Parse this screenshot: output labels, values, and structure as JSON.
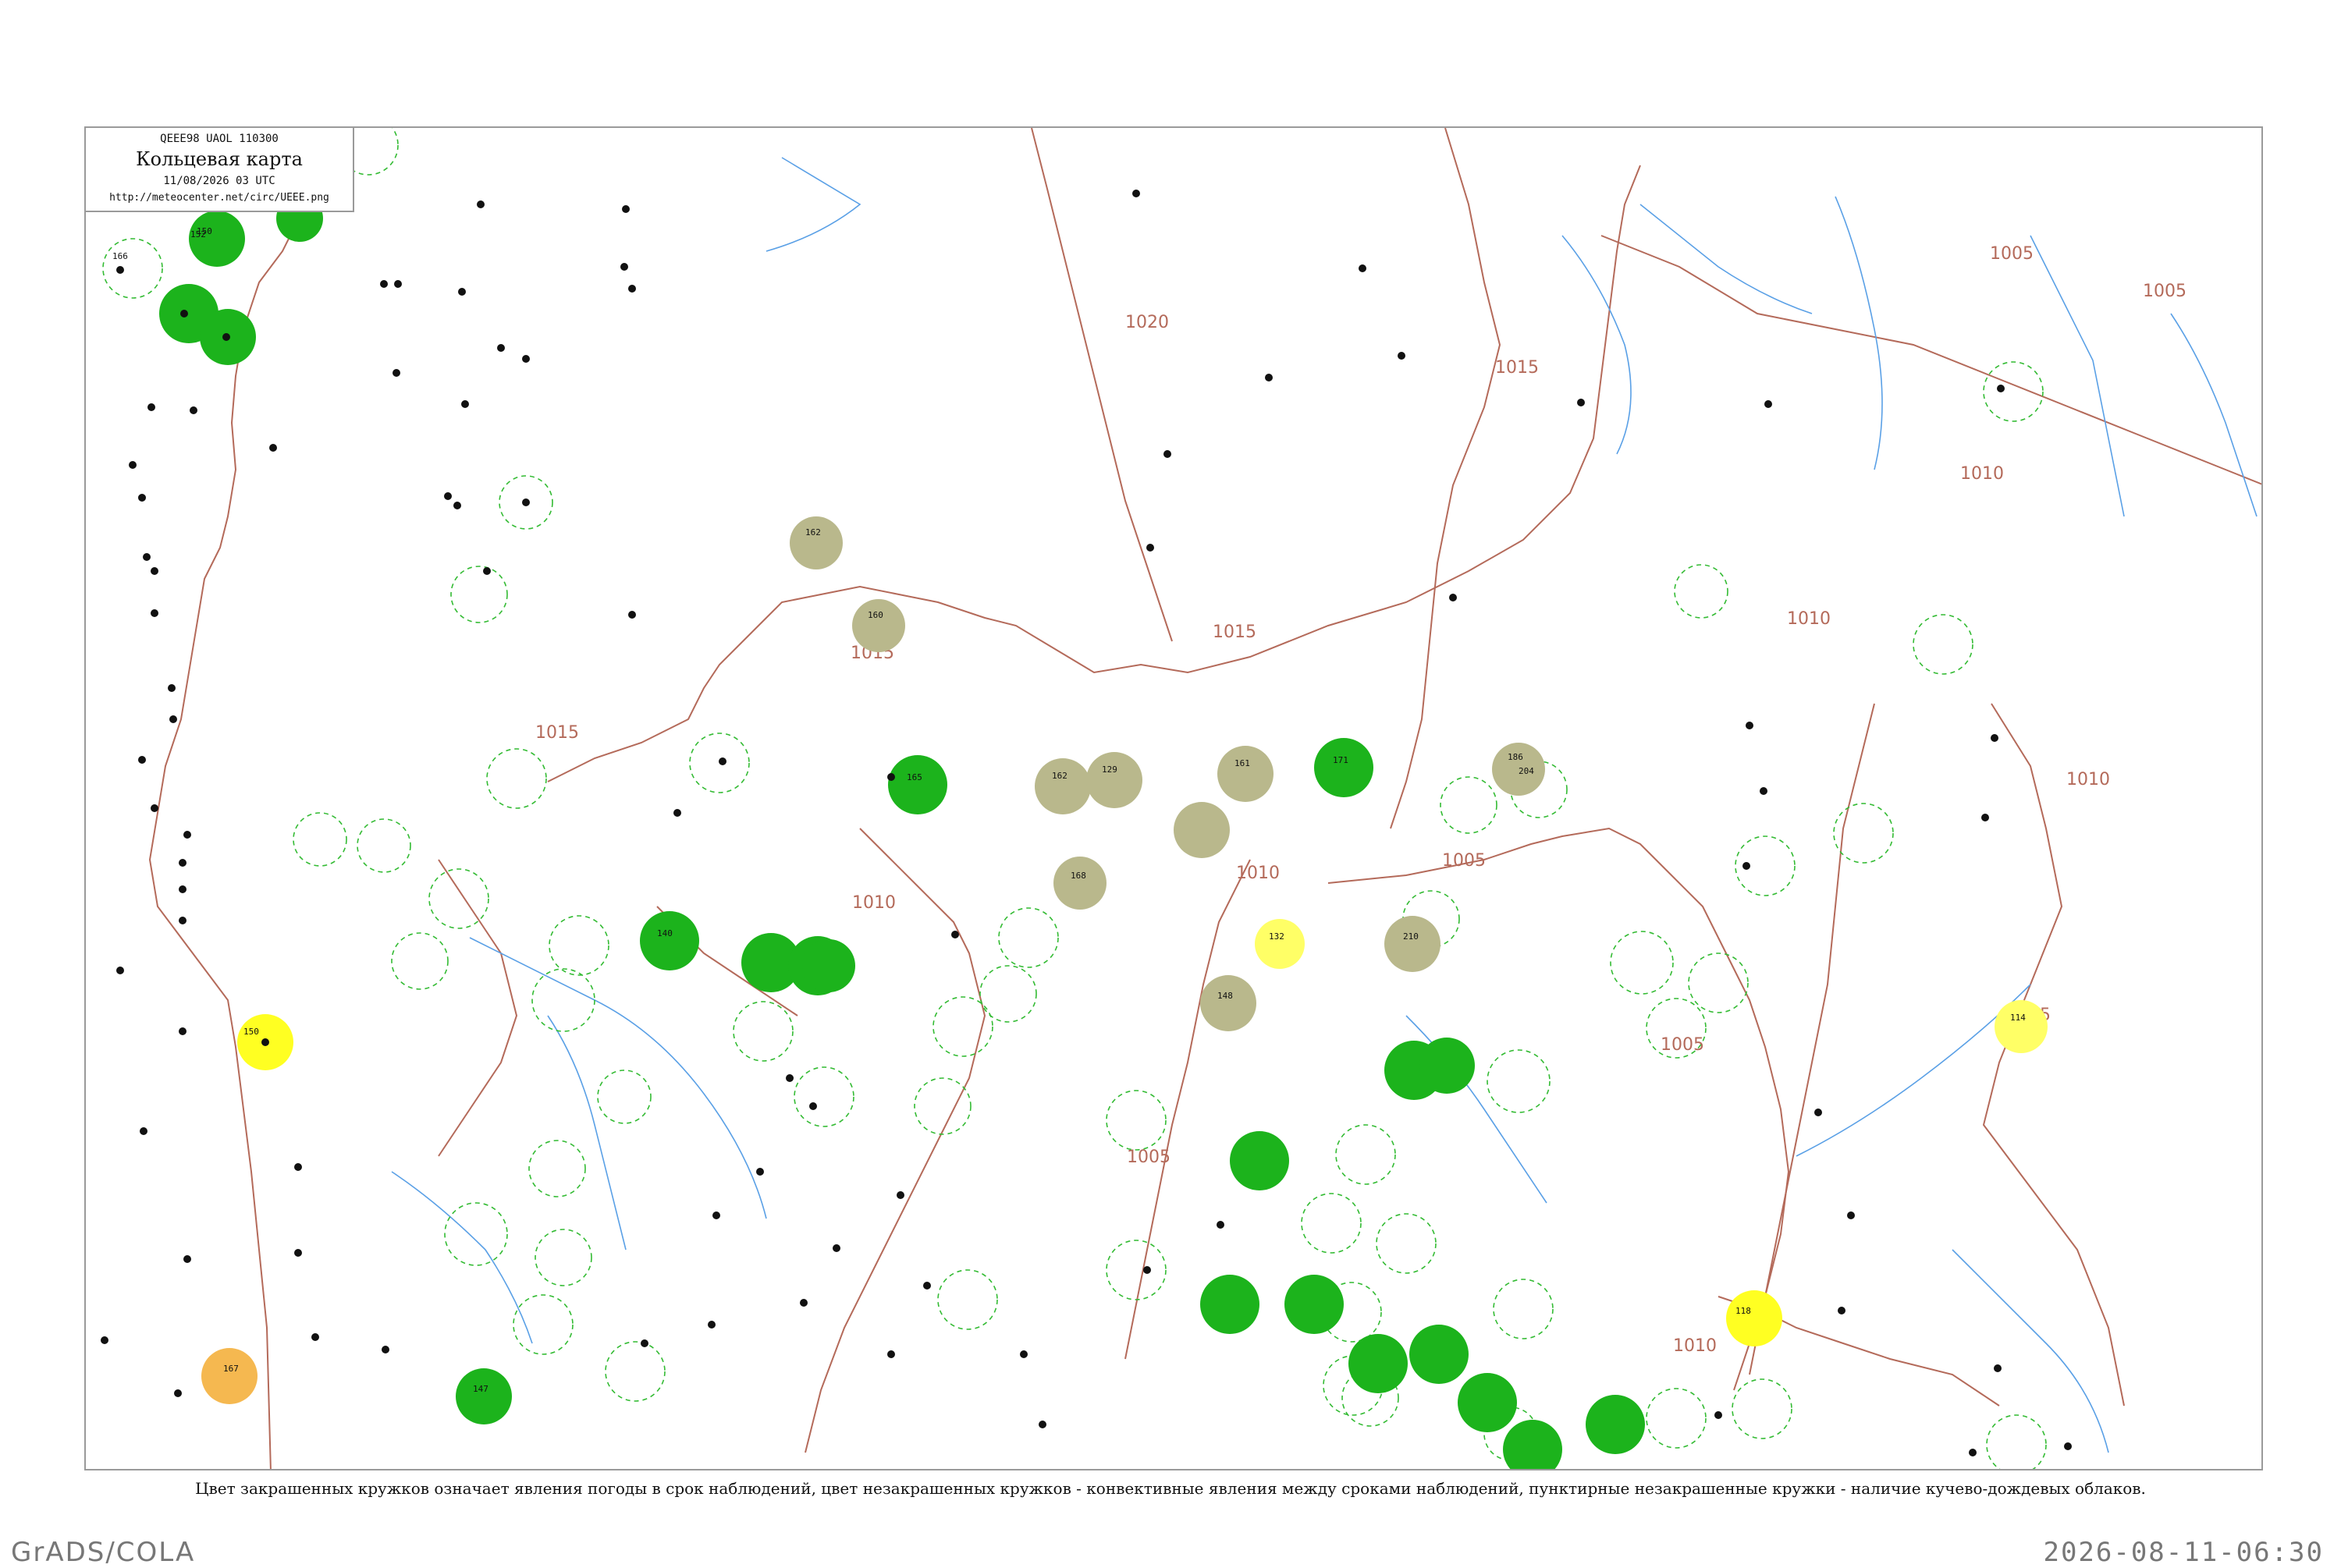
{
  "header": {
    "code": "QEEE98  UAOL  110300",
    "title": "Кольцевая карта",
    "datetime": "11/08/2026 03 UTC",
    "url": "http://meteocenter.net/circ/UEEE.png"
  },
  "caption": "Цвет закрашенных кружков означает явления погоды в срок наблюдений, цвет незакрашенных кружков - конвективные явления между сроками наблюдений, пунктирные незакрашенные кружки - наличие кучево-дождевых облаков.",
  "footer": {
    "left": "GrADS/COLA",
    "right": "2026-08-11-06:30"
  },
  "colors": {
    "isobar": "#b46a5a",
    "river": "#5aa0e6",
    "green_fill": "#1cb31c",
    "khaki_fill": "#b9b88c",
    "yellow_fill": "#ffff22",
    "orange_fill": "#f5b850",
    "dashed_circle": "#33bb33"
  },
  "isobars": [
    {
      "label": "1020"
    },
    {
      "label": "1015"
    },
    {
      "label": "1015"
    },
    {
      "label": "1015"
    },
    {
      "label": "1015"
    },
    {
      "label": "1010"
    },
    {
      "label": "1010"
    },
    {
      "label": "1010"
    },
    {
      "label": "1010"
    },
    {
      "label": "1010"
    },
    {
      "label": "1005"
    },
    {
      "label": "1005"
    },
    {
      "label": "1005"
    },
    {
      "label": "1005"
    },
    {
      "label": "1005"
    },
    {
      "label": "1005"
    },
    {
      "label": "1010"
    }
  ],
  "stations": [
    {
      "num": "166",
      "name": "",
      "mark": "green"
    },
    {
      "num": "150",
      "name": "",
      "mark": "green"
    },
    {
      "num": "162",
      "name": "",
      "mark": "khaki"
    },
    {
      "num": "160",
      "name": "",
      "mark": "khaki"
    },
    {
      "num": "162",
      "name": "",
      "mark": "khaki"
    },
    {
      "num": "129",
      "name": "",
      "mark": "khaki"
    },
    {
      "num": "161",
      "name": "",
      "mark": "khaki"
    },
    {
      "num": "186",
      "name": "",
      "mark": "khaki"
    },
    {
      "num": "204",
      "name": "",
      "mark": "khaki"
    },
    {
      "num": "168",
      "name": "",
      "mark": "khaki"
    },
    {
      "num": "132",
      "name": "",
      "mark": "yellow"
    },
    {
      "num": "210",
      "name": "",
      "mark": "khaki"
    },
    {
      "num": "148",
      "name": "",
      "mark": "khaki"
    },
    {
      "num": "150",
      "name": "",
      "mark": "yellow"
    },
    {
      "num": "114",
      "name": "",
      "mark": "yellow"
    },
    {
      "num": "118",
      "name": "",
      "mark": "yellow"
    },
    {
      "num": "167",
      "name": "",
      "mark": "orange"
    },
    {
      "num": "152",
      "name": "",
      "mark": "green"
    },
    {
      "num": "165",
      "name": "",
      "mark": "green"
    },
    {
      "num": "171",
      "name": "",
      "mark": "green"
    },
    {
      "num": "140",
      "name": "",
      "mark": "green"
    },
    {
      "num": "147",
      "name": "",
      "mark": "green"
    }
  ]
}
